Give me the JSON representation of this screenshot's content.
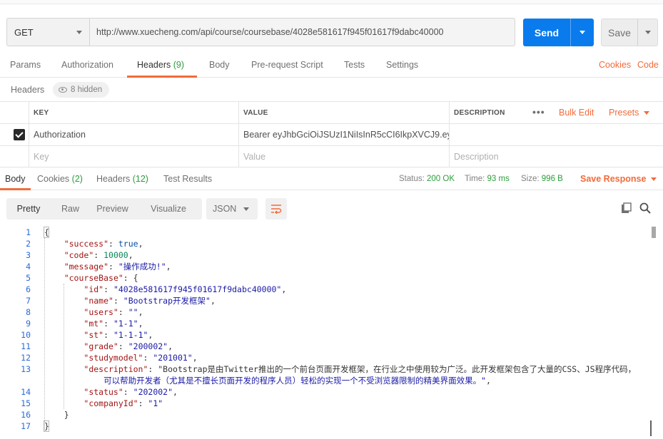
{
  "request": {
    "method": "GET",
    "url": "http://www.xuecheng.com/api/course/coursebase/4028e581617f945f01617f9dabc40000",
    "send_label": "Send",
    "save_label": "Save"
  },
  "request_tabs": [
    {
      "label": "Params"
    },
    {
      "label": "Authorization"
    },
    {
      "label": "Headers",
      "count": "(9)"
    },
    {
      "label": "Body"
    },
    {
      "label": "Pre-request Script"
    },
    {
      "label": "Tests"
    },
    {
      "label": "Settings"
    }
  ],
  "request_links": {
    "cookies": "Cookies",
    "code": "Code"
  },
  "headers_section": {
    "title": "Headers",
    "hidden": "8 hidden"
  },
  "headers_table": {
    "columns": {
      "key": "KEY",
      "value": "VALUE",
      "description": "DESCRIPTION"
    },
    "more": "•••",
    "bulk_edit": "Bulk Edit",
    "presets": "Presets",
    "rows": [
      {
        "key": "Authorization",
        "value": "Bearer eyJhbGciOiJSUzI1NiIsInR5cCI6IkpXVCJ9.ey..."
      }
    ],
    "placeholders": {
      "key": "Key",
      "value": "Value",
      "description": "Description"
    }
  },
  "response_tabs": [
    {
      "label": "Body"
    },
    {
      "label": "Cookies",
      "count": "(2)"
    },
    {
      "label": "Headers",
      "count": "(12)"
    },
    {
      "label": "Test Results"
    }
  ],
  "response_status": {
    "status_label": "Status:",
    "status_value": "200 OK",
    "time_label": "Time:",
    "time_value": "93 ms",
    "size_label": "Size:",
    "size_value": "996 B",
    "save_response": "Save Response"
  },
  "view_modes": [
    "Pretty",
    "Raw",
    "Preview",
    "Visualize"
  ],
  "format": "JSON",
  "icons": {
    "wrap": "wrap-lines-icon",
    "copy": "copy-icon",
    "search": "search-icon"
  },
  "colors": {
    "accent": "#f26b3a",
    "send": "#097bed",
    "ok": "#2a9e3a"
  },
  "code": {
    "line_numbers": [
      "1",
      "2",
      "3",
      "4",
      "5",
      "6",
      "7",
      "8",
      "9",
      "10",
      "11",
      "12",
      "13",
      "14",
      "15",
      "16",
      "17"
    ],
    "lines": [
      "{",
      "    \"success\": true,",
      "    \"code\": 10000,",
      "    \"message\": \"操作成功!\",",
      "    \"courseBase\": {",
      "        \"id\": \"4028e581617f945f01617f9dabc40000\",",
      "        \"name\": \"Bootstrap开发框架\",",
      "        \"users\": \"\",",
      "        \"mt\": \"1-1\",",
      "        \"st\": \"1-1-1\",",
      "        \"grade\": \"200002\",",
      "        \"studymodel\": \"201001\",",
      "        \"description\": \"Bootstrap是由Twitter推出的一个前台页面开发框架，在行业之中使用较为广泛。此开发框架包含了大量的CSS、JS程序代码，",
      "            可以帮助开发者（尤其是不擅长页面开发的程序人员）轻松的实现一个不受浏览器限制的精美界面效果。\",",
      "        \"status\": \"202002\",",
      "        \"companyId\": \"1\"",
      "    }",
      "}"
    ]
  }
}
